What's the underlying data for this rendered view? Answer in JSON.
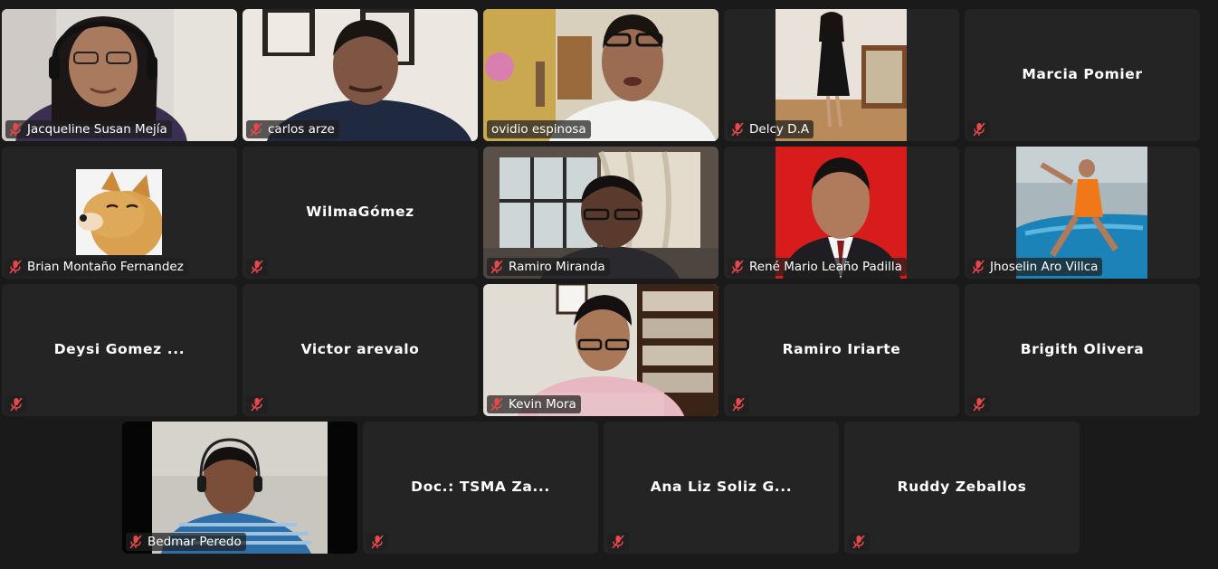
{
  "meeting": {
    "active_speaker_color": "#2cc84a",
    "tile_background": "#242424",
    "muted_icon": "mic-muted-icon",
    "muted_icon_color": "#e8484a"
  },
  "participants": [
    {
      "name": "Jacqueline Susan Mejía",
      "video": true,
      "muted": true
    },
    {
      "name": "carlos arze",
      "video": true,
      "muted": true
    },
    {
      "name": "ovidio espinosa",
      "video": true,
      "muted": false,
      "speaking": true
    },
    {
      "name": "Delcy D.A",
      "video": true,
      "muted": true
    },
    {
      "name": "Marcia Pomier",
      "video": false,
      "muted": true
    },
    {
      "name": "Brian Montaño Fernandez",
      "video": true,
      "muted": true
    },
    {
      "name": "WilmaGómez",
      "video": false,
      "muted": true
    },
    {
      "name": "Ramiro Miranda",
      "video": true,
      "muted": true
    },
    {
      "name": "René Mario Leaño Padilla",
      "video": true,
      "muted": true
    },
    {
      "name": "Jhoselin Aro Villca",
      "video": true,
      "muted": true
    },
    {
      "name": "Deysi Gomez ...",
      "video": false,
      "muted": true
    },
    {
      "name": "Victor arevalo",
      "video": false,
      "muted": true
    },
    {
      "name": "Kevin Mora",
      "video": true,
      "muted": true
    },
    {
      "name": "Ramiro Iriarte",
      "video": false,
      "muted": true
    },
    {
      "name": "Brigith Olivera",
      "video": false,
      "muted": true
    },
    {
      "name": "Bedmar Peredo",
      "video": true,
      "muted": true
    },
    {
      "name": "Doc.: TSMA Za...",
      "video": false,
      "muted": true
    },
    {
      "name": "Ana Liz Soliz G...",
      "video": false,
      "muted": true
    },
    {
      "name": "Ruddy Zeballos",
      "video": false,
      "muted": true
    }
  ]
}
